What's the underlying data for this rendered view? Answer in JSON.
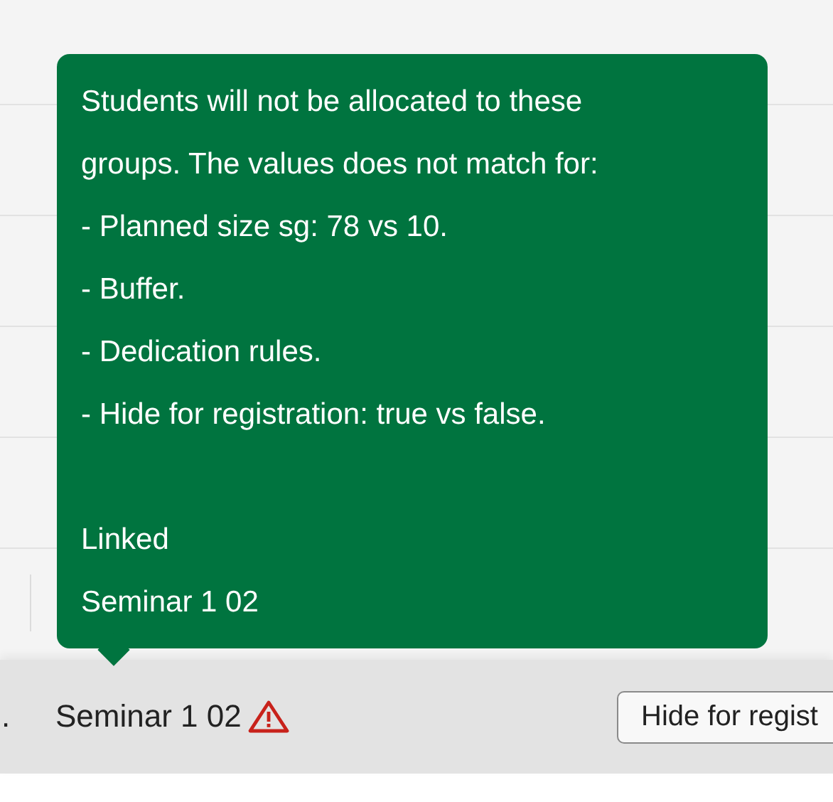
{
  "tooltip": {
    "message": [
      "Students will not be allocated to these groups. The values does not match for:",
      "- Planned size sg: 78 vs 10.",
      "- Buffer.",
      "- Dedication rules.",
      "- Hide for registration: true vs false."
    ],
    "linked_label": "Linked",
    "linked_groups": [
      "Seminar 1 02"
    ]
  },
  "row": {
    "cell_1": ".",
    "group_name": "Seminar 1 02",
    "warning": true,
    "button": "Hide for regist"
  }
}
